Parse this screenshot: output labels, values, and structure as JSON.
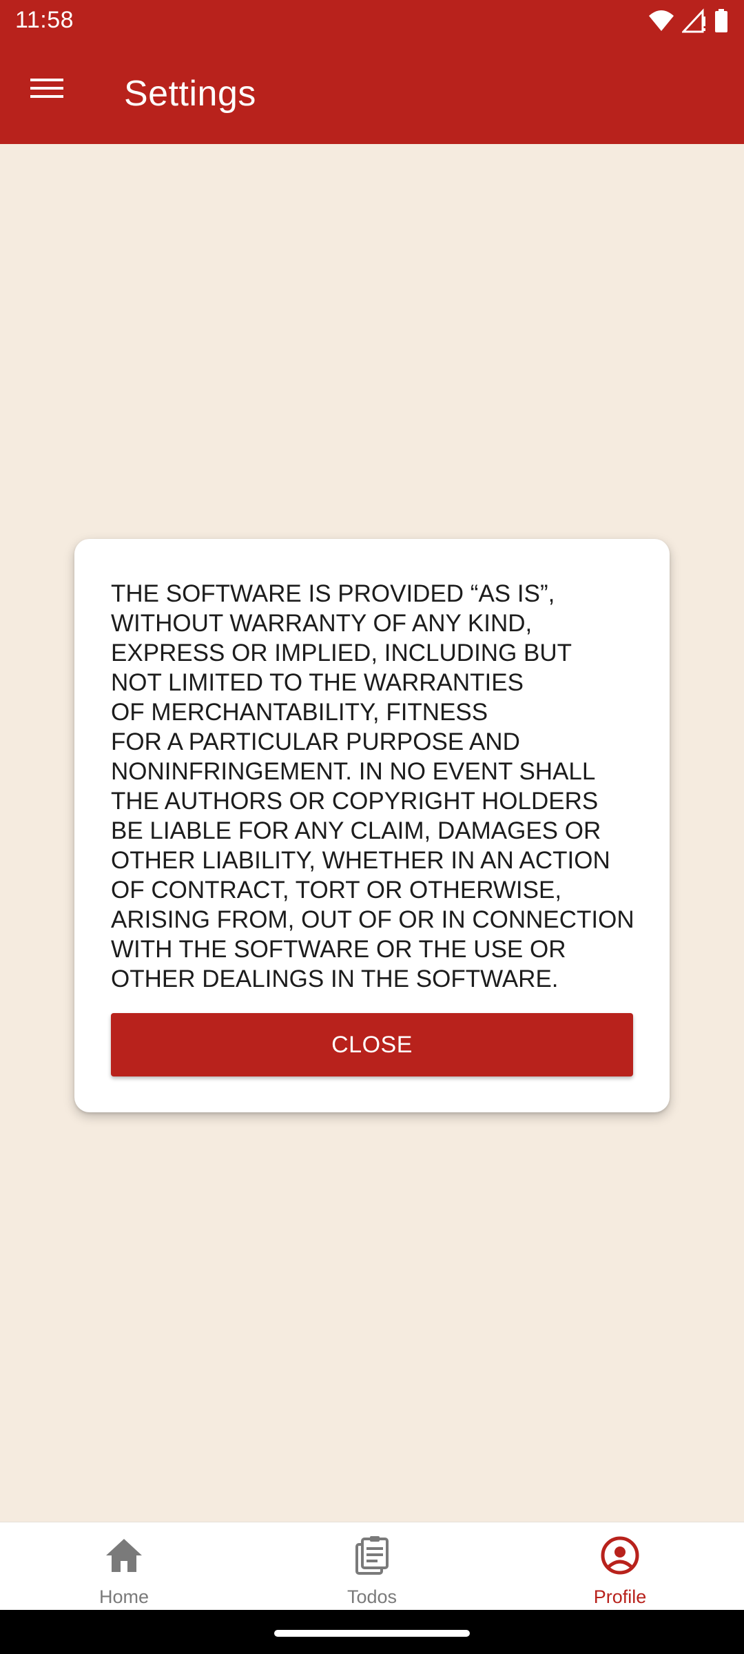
{
  "status_bar": {
    "time": "11:58"
  },
  "app_bar": {
    "title": "Settings"
  },
  "dialog": {
    "text": "THE SOFTWARE IS PROVIDED “AS IS”,\nWITHOUT WARRANTY OF ANY KIND,\nEXPRESS OR IMPLIED, INCLUDING BUT\nNOT LIMITED TO THE WARRANTIES\nOF MERCHANTABILITY, FITNESS\nFOR A PARTICULAR PURPOSE AND\nNONINFRINGEMENT. IN NO EVENT SHALL\nTHE AUTHORS OR COPYRIGHT HOLDERS\nBE LIABLE FOR ANY CLAIM, DAMAGES OR\nOTHER LIABILITY, WHETHER IN AN ACTION\nOF CONTRACT, TORT OR OTHERWISE,\nARISING FROM, OUT OF OR IN CONNECTION\nWITH THE SOFTWARE OR THE USE OR\nOTHER DEALINGS IN THE SOFTWARE.",
    "close_label": "CLOSE"
  },
  "bottom_nav": {
    "items": [
      {
        "label": "Home",
        "icon": "home-icon",
        "active": false
      },
      {
        "label": "Todos",
        "icon": "clipboard-icon",
        "active": false
      },
      {
        "label": "Profile",
        "icon": "account-circle-icon",
        "active": true
      }
    ]
  },
  "colors": {
    "primary": "#b8221c",
    "background": "#f5ebdf",
    "inactive": "#7a7a7a"
  }
}
